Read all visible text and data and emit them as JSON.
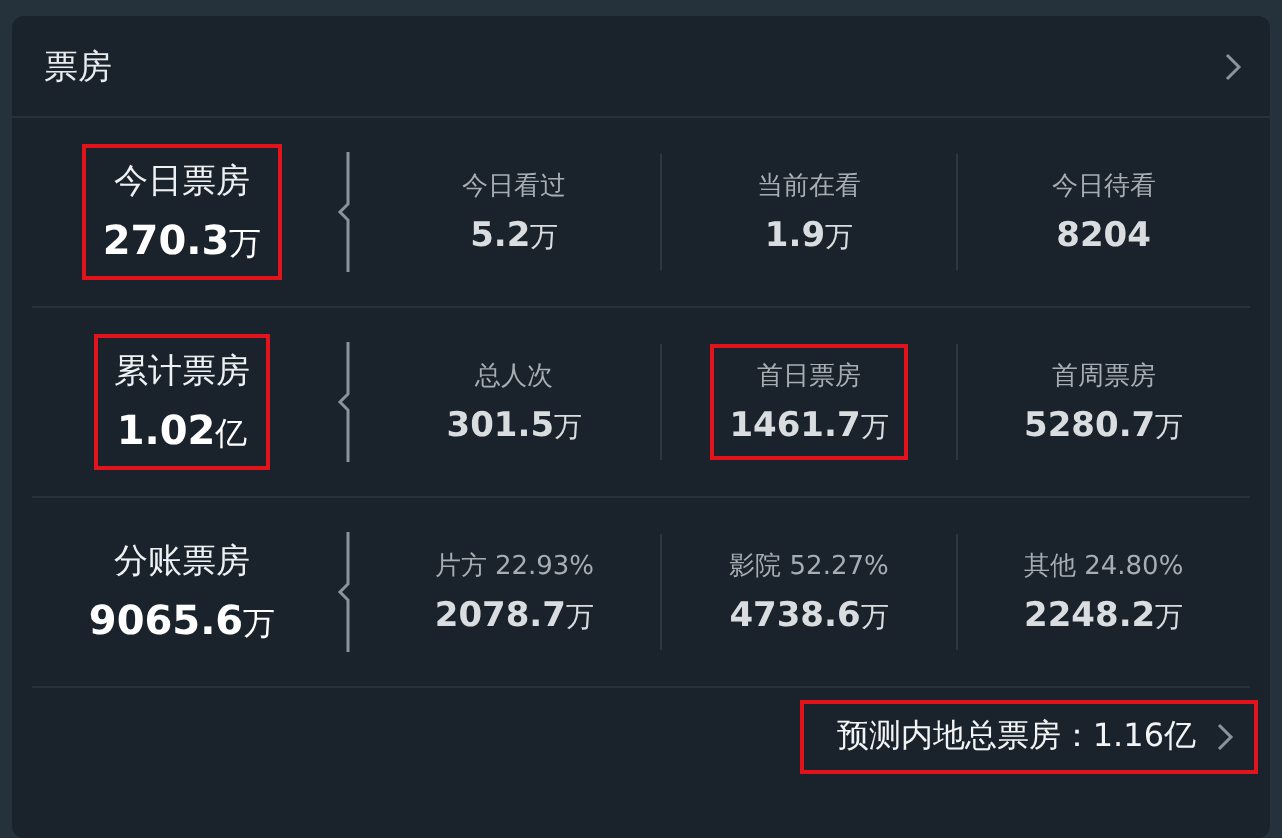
{
  "card": {
    "title": "票房"
  },
  "rows": [
    {
      "main": {
        "label": "今日票房",
        "value": "270.3",
        "unit": "万",
        "highlighted": true
      },
      "stats": [
        {
          "label": "今日看过",
          "value": "5.2",
          "unit": "万",
          "highlighted": false
        },
        {
          "label": "当前在看",
          "value": "1.9",
          "unit": "万",
          "highlighted": false
        },
        {
          "label": "今日待看",
          "value": "8204",
          "highlighted": false
        }
      ]
    },
    {
      "main": {
        "label": "累计票房",
        "value": "1.02",
        "unit": "亿",
        "highlighted": true
      },
      "stats": [
        {
          "label": "总人次",
          "value": "301.5",
          "unit": "万",
          "highlighted": false
        },
        {
          "label": "首日票房",
          "value": "1461.7",
          "unit": "万",
          "highlighted": true
        },
        {
          "label": "首周票房",
          "value": "5280.7",
          "unit": "万",
          "highlighted": false
        }
      ]
    },
    {
      "main": {
        "label": "分账票房",
        "value": "9065.6",
        "unit": "万",
        "highlighted": false
      },
      "stats": [
        {
          "label": "片方 22.93%",
          "value": "2078.7",
          "unit": "万",
          "highlighted": false
        },
        {
          "label": "影院 52.27%",
          "value": "4738.6",
          "unit": "万",
          "highlighted": false
        },
        {
          "label": "其他 24.80%",
          "value": "2248.2",
          "unit": "万",
          "highlighted": false
        }
      ]
    }
  ],
  "footer": {
    "text": "预测内地总票房：1.16亿",
    "highlighted": true
  }
}
